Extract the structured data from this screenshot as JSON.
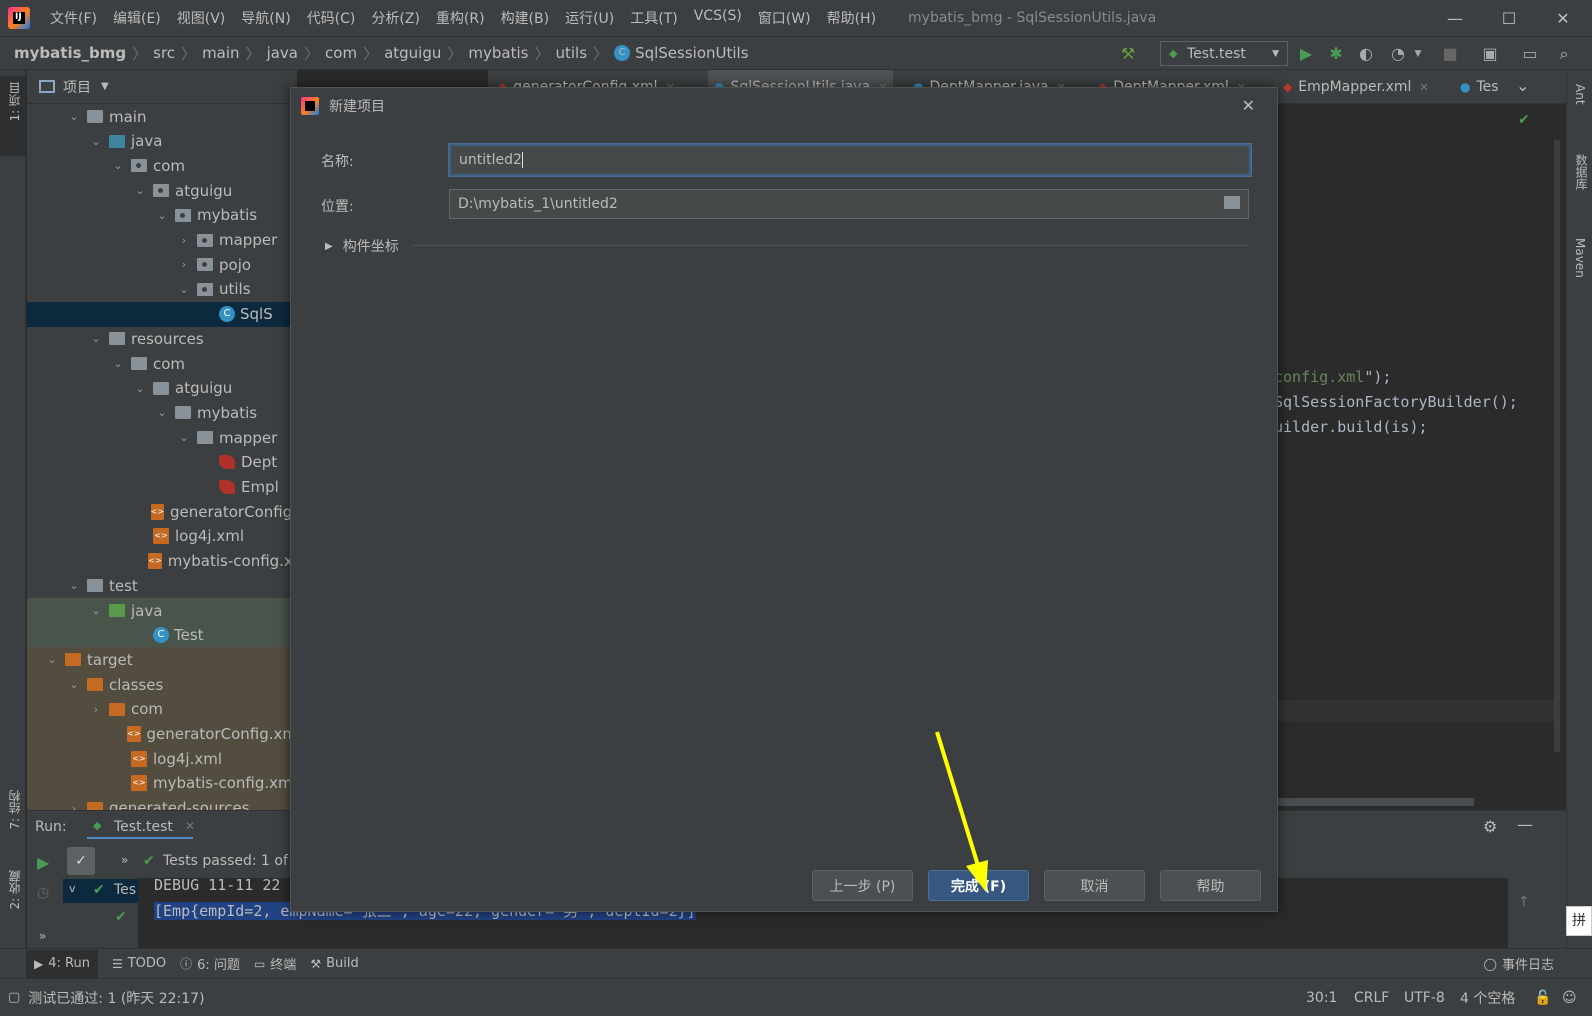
{
  "titlebar": {
    "menu": [
      "文件(F)",
      "编辑(E)",
      "视图(V)",
      "导航(N)",
      "代码(C)",
      "分析(Z)",
      "重构(R)",
      "构建(B)",
      "运行(U)",
      "工具(T)",
      "VCS(S)",
      "窗口(W)",
      "帮助(H)"
    ],
    "window_title": "mybatis_bmg - SqlSessionUtils.java"
  },
  "breadcrumb": [
    "mybatis_bmg",
    "src",
    "main",
    "java",
    "com",
    "atguigu",
    "mybatis",
    "utils",
    "SqlSessionUtils"
  ],
  "run_config": "Test.test",
  "left_stripe": {
    "project": "1: 项目",
    "structure": "7: 结构",
    "favorites": "2: 收藏"
  },
  "right_stripe": {
    "ant": "Ant",
    "database": "数据库",
    "maven": "Maven"
  },
  "project_panel": {
    "title": "项目",
    "tree": [
      {
        "label": "main",
        "depth": 2,
        "expanded": true,
        "icon": "folder-grey"
      },
      {
        "label": "java",
        "depth": 3,
        "expanded": true,
        "icon": "folder-blue"
      },
      {
        "label": "com",
        "depth": 4,
        "expanded": true,
        "icon": "package"
      },
      {
        "label": "atguigu",
        "depth": 5,
        "expanded": true,
        "icon": "package"
      },
      {
        "label": "mybatis",
        "depth": 6,
        "expanded": true,
        "icon": "package"
      },
      {
        "label": "mapper",
        "depth": 7,
        "expanded": false,
        "icon": "package"
      },
      {
        "label": "pojo",
        "depth": 7,
        "expanded": false,
        "icon": "package"
      },
      {
        "label": "utils",
        "depth": 7,
        "expanded": true,
        "icon": "package"
      },
      {
        "label": "SqlS",
        "depth": 8,
        "icon": "class",
        "selected": true
      },
      {
        "label": "resources",
        "depth": 3,
        "expanded": true,
        "icon": "folder-grey"
      },
      {
        "label": "com",
        "depth": 4,
        "expanded": true,
        "icon": "folder-grey"
      },
      {
        "label": "atguigu",
        "depth": 5,
        "expanded": true,
        "icon": "folder-grey"
      },
      {
        "label": "mybatis",
        "depth": 6,
        "expanded": true,
        "icon": "folder-grey"
      },
      {
        "label": "mapper",
        "depth": 7,
        "expanded": true,
        "icon": "folder-grey"
      },
      {
        "label": "Dept",
        "depth": 8,
        "icon": "mybatis"
      },
      {
        "label": "Empl",
        "depth": 8,
        "icon": "mybatis"
      },
      {
        "label": "generatorConfig.",
        "depth": 5,
        "icon": "xml"
      },
      {
        "label": "log4j.xml",
        "depth": 5,
        "icon": "xml"
      },
      {
        "label": "mybatis-config.xı",
        "depth": 5,
        "icon": "xml"
      },
      {
        "label": "test",
        "depth": 2,
        "expanded": true,
        "icon": "folder-grey"
      },
      {
        "label": "java",
        "depth": 3,
        "expanded": true,
        "icon": "folder-green",
        "bg": "test"
      },
      {
        "label": "Test",
        "depth": 5,
        "icon": "class",
        "bg": "test"
      },
      {
        "label": "target",
        "depth": 1,
        "expanded": true,
        "icon": "folder-orange",
        "bg": "target"
      },
      {
        "label": "classes",
        "depth": 2,
        "expanded": true,
        "icon": "folder-orange",
        "bg": "target"
      },
      {
        "label": "com",
        "depth": 3,
        "expanded": false,
        "icon": "folder-orange",
        "bg": "target"
      },
      {
        "label": "generatorConfig.xm",
        "depth": 4,
        "icon": "xml",
        "bg": "target"
      },
      {
        "label": "log4j.xml",
        "depth": 4,
        "icon": "xml",
        "bg": "target"
      },
      {
        "label": "mybatis-config.xml",
        "depth": 4,
        "icon": "xml",
        "bg": "target"
      },
      {
        "label": "generated-sources",
        "depth": 2,
        "expanded": false,
        "icon": "folder-orange",
        "bg": "target"
      }
    ]
  },
  "tabs": [
    "generatorConfig.xml",
    "SqlSessionUtils.java",
    "DeptMapper.java",
    "DeptMapper.xml",
    "EmpMapper.xml",
    "Tes"
  ],
  "code_fragments": [
    {
      "text": "config.xml",
      "tail": "\");",
      "kind": "string"
    },
    {
      "text": "SqlSessionFactoryBuilder();",
      "kind": "code"
    },
    {
      "text": "uilder.build(is);",
      "kind": "code"
    }
  ],
  "dialog": {
    "title": "新建项目",
    "name_label": "名称:",
    "name_value": "untitled2",
    "location_label": "位置:",
    "location_value": "D:\\mybatis_1\\untitled2",
    "artifact_coords": "构件坐标",
    "buttons": {
      "prev": "上一步 (P)",
      "finish": "完成 (F)",
      "cancel": "取消",
      "help": "帮助"
    }
  },
  "run_panel": {
    "label": "Run:",
    "tab": "Test.test",
    "status": "Tests passed: 1 of",
    "tree_item": "Tes",
    "console": [
      "DEBUG 11-11 22",
      "[Emp{empId=2, empName='张三', age=22, gender='男', deptId=2}]"
    ]
  },
  "tool_windows": [
    "4: Run",
    "TODO",
    "6: 问题",
    "终端",
    "Build"
  ],
  "event_log": "事件日志",
  "statusbar": {
    "message": "测试已通过: 1 (昨天 22:17)",
    "position": "30:1",
    "line_sep": "CRLF",
    "encoding": "UTF-8",
    "indent": "4 个空格"
  },
  "colors": {
    "accent": "#365880",
    "annotation_arrow": "#ffff00",
    "run_green": "#499c54"
  }
}
